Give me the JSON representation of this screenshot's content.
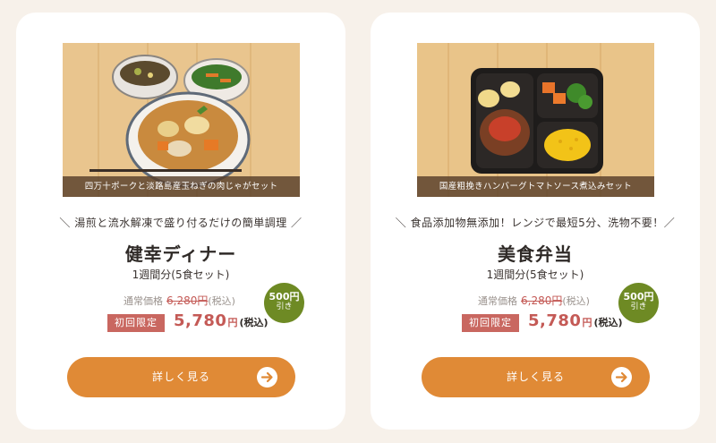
{
  "cards": [
    {
      "image_caption": "四万十ポークと淡路島産玉ねぎの肉じゃがセット",
      "tagline": "＼ 湯煎と流水解凍で盛り付るだけの簡単調理 ／",
      "name": "健幸ディナー",
      "quantity": "1週間分(5食セット)",
      "regular_label": "通常価格",
      "regular_price": "6,280円",
      "regular_tax": "(税込)",
      "limited_label": "初回限定",
      "sale_amount": "5,780",
      "sale_yen": "円",
      "sale_tax": "(税込)",
      "discount_line1": "500円",
      "discount_line2": "引き",
      "cta_label": "詳しく見る",
      "cta_icon": "arrow-right-icon"
    },
    {
      "image_caption": "国産粗挽きハンバーグトマトソース煮込みセット",
      "tagline": "＼ 食品添加物無添加！レンジで最短5分、洗物不要！／",
      "name": "美食弁当",
      "quantity": "1週間分(5食セット)",
      "regular_label": "通常価格",
      "regular_price": "6,280円",
      "regular_tax": "(税込)",
      "limited_label": "初回限定",
      "sale_amount": "5,780",
      "sale_yen": "円",
      "sale_tax": "(税込)",
      "discount_line1": "500円",
      "discount_line2": "引き",
      "cta_label": "詳しく見る",
      "cta_icon": "arrow-right-icon"
    }
  ],
  "colors": {
    "page_bg": "#f7f1ea",
    "cta": "#e08a36",
    "sale_red": "#c45a56",
    "limited_badge": "#c96760",
    "discount_green": "#6e8a24"
  }
}
